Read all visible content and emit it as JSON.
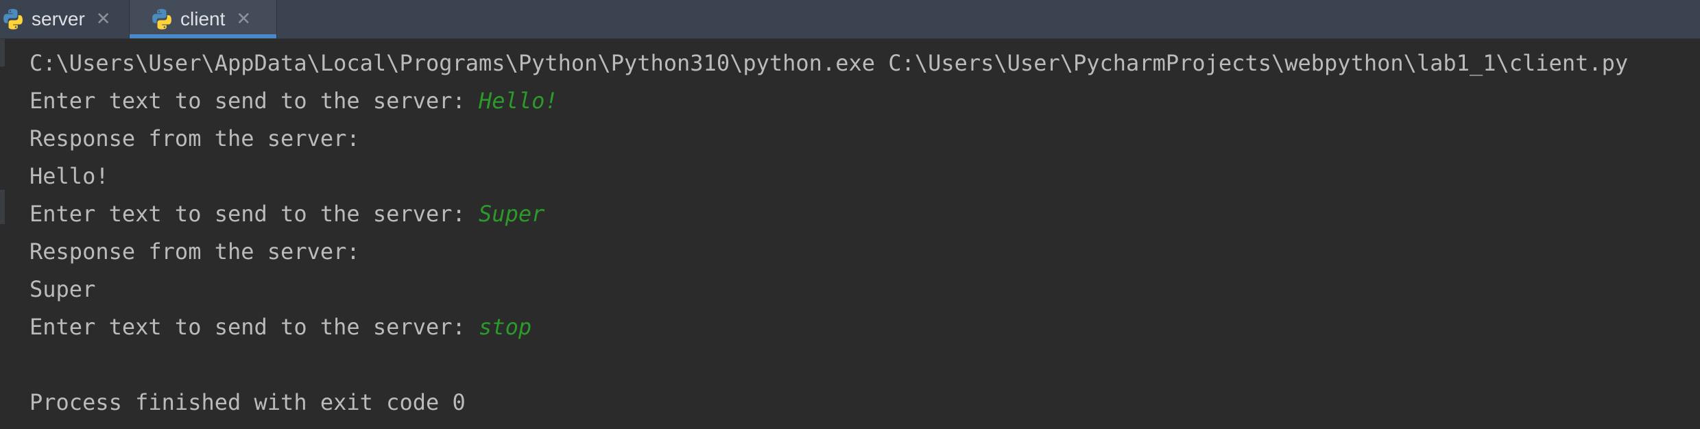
{
  "tabs": [
    {
      "label": "server",
      "active": false,
      "icon": "python-icon"
    },
    {
      "label": "client",
      "active": true,
      "icon": "python-icon"
    }
  ],
  "colors": {
    "tabbar_bg": "#3c4350",
    "active_tab_indicator": "#4a88c7",
    "console_bg": "#2b2b2b",
    "output_text": "#bbbbbb",
    "user_input_text": "#2b9a2b"
  },
  "console": {
    "lines": [
      {
        "text": "C:\\Users\\User\\AppData\\Local\\Programs\\Python\\Python310\\python.exe C:\\Users\\User\\PycharmProjects\\webpython\\lab1_1\\client.py",
        "input": ""
      },
      {
        "text": "Enter text to send to the server: ",
        "input": "Hello!"
      },
      {
        "text": "Response from the server:",
        "input": ""
      },
      {
        "text": "Hello!",
        "input": ""
      },
      {
        "text": "Enter text to send to the server: ",
        "input": "Super"
      },
      {
        "text": "Response from the server:",
        "input": ""
      },
      {
        "text": "Super",
        "input": ""
      },
      {
        "text": "Enter text to send to the server: ",
        "input": "stop"
      },
      {
        "text": "",
        "input": ""
      },
      {
        "text": "Process finished with exit code 0",
        "input": ""
      }
    ]
  }
}
